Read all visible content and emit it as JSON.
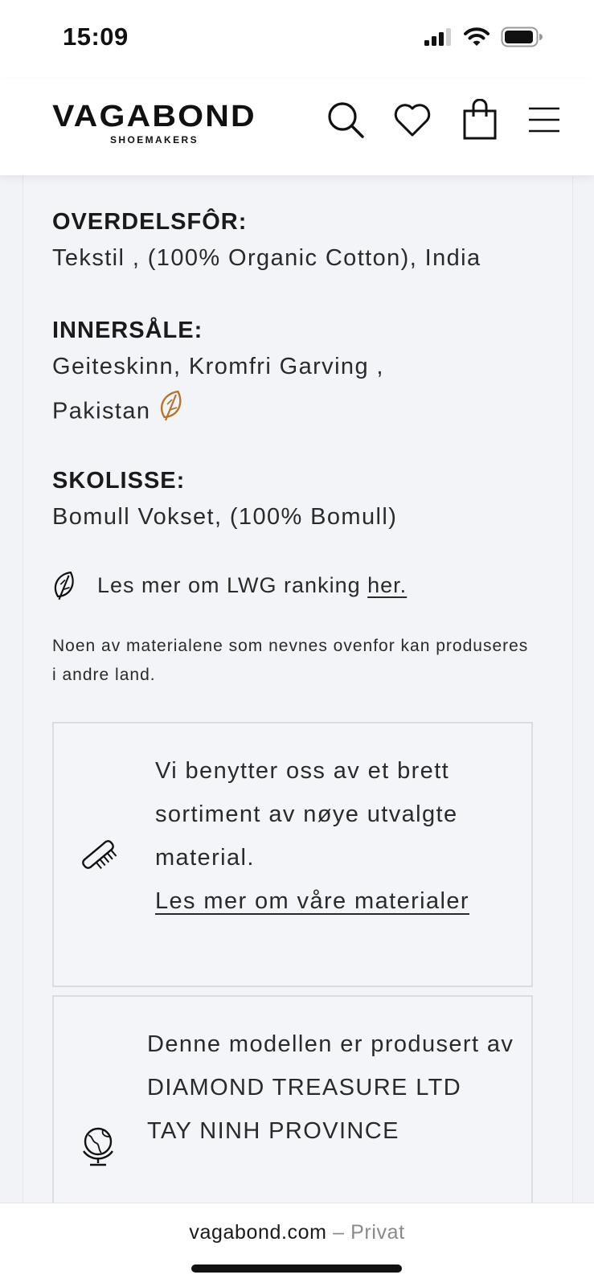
{
  "status_bar": {
    "time": "15:09",
    "icons": [
      "signal-icon",
      "wifi-icon",
      "battery-icon"
    ]
  },
  "header": {
    "logo_main": "VAGABOND",
    "logo_sub": "SHOEMAKERS",
    "icons": [
      "search-icon",
      "heart-icon",
      "bag-icon",
      "menu-icon"
    ]
  },
  "specs": [
    {
      "label": "OVERDELSFÔR:",
      "value": "Tekstil , (100% Organic Cotton), India"
    },
    {
      "label": "INNERSÅLE:",
      "value": "Geiteskinn, Kromfri Garving , Pakistan"
    },
    {
      "label": "SKOLISSE:",
      "value": "Bomull Vokset, (100% Bomull)"
    }
  ],
  "lwg": {
    "text": "Les mer om LWG ranking",
    "link": "her."
  },
  "note": "Noen av materialene som nevnes ovenfor kan produseres i andre land.",
  "cards": {
    "materials": {
      "text": "Vi benytter oss av et brett sortiment av nøye utvalgte material.",
      "link": "Les mer om våre materialer"
    },
    "producer": {
      "intro": "Denne modellen er produsert av",
      "company": "DIAMOND TREASURE LTD",
      "location": "TAY NINH PROVINCE"
    }
  },
  "browser": {
    "domain": "vagabond.com",
    "separator": " – Privat"
  },
  "colors": {
    "accent_leaf": "#b8742c",
    "background": "#f2f3f7",
    "text": "#1b1b1b"
  }
}
